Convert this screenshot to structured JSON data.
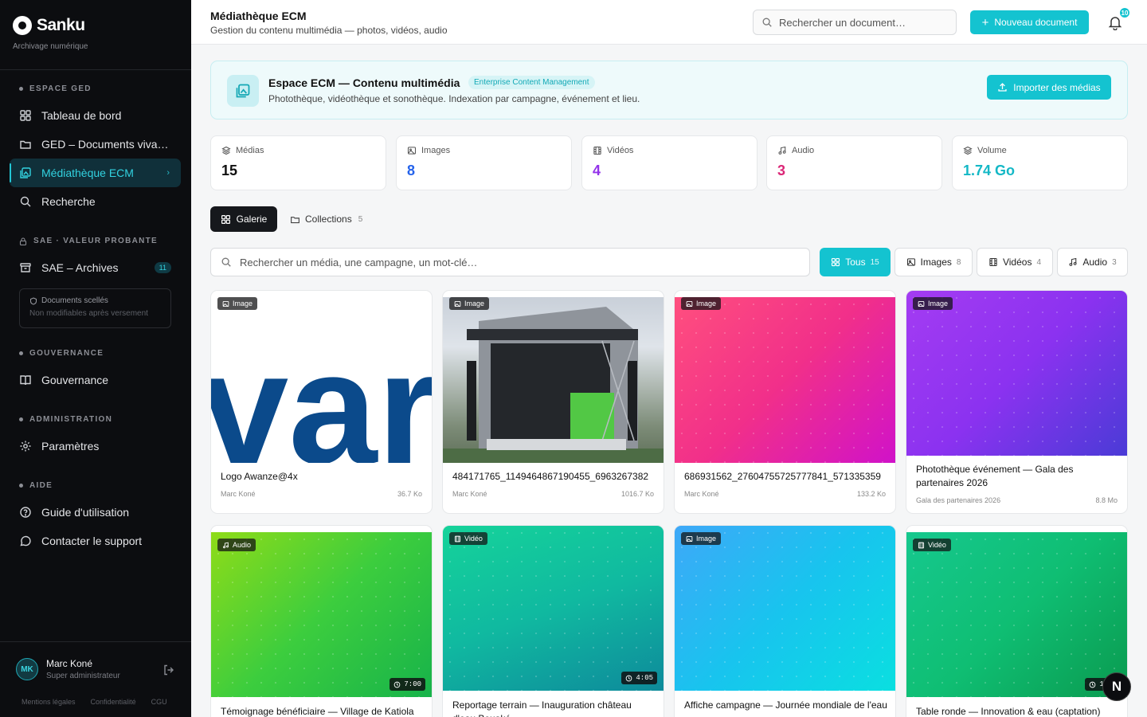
{
  "brand": {
    "name": "Sanku",
    "tagline": "Archivage numérique"
  },
  "sidebar": {
    "sections": [
      "ESPACE GED",
      "SAE · VALEUR PROBANTE",
      "GOUVERNANCE",
      "ADMINISTRATION",
      "AIDE"
    ],
    "items": [
      {
        "label": "Tableau de bord"
      },
      {
        "label": "GED – Documents vivants"
      },
      {
        "label": "Médiathèque ECM"
      },
      {
        "label": "Recherche"
      },
      {
        "label": "SAE – Archives",
        "badge": "11"
      },
      {
        "label": "Gouvernance"
      },
      {
        "label": "Paramètres"
      },
      {
        "label": "Guide d'utilisation"
      },
      {
        "label": "Contacter le support"
      }
    ],
    "sealed": {
      "title": "Documents scellés",
      "subtitle": "Non modifiables après versement"
    },
    "user": {
      "initials": "MK",
      "name": "Marc Koné",
      "role": "Super administrateur"
    },
    "footer": [
      "Mentions légales",
      "Confidentialité",
      "CGU"
    ]
  },
  "topbar": {
    "title": "Médiathèque ECM",
    "subtitle": "Gestion du contenu multimédia — photos, vidéos, audio",
    "search_placeholder": "Rechercher un document…",
    "new_doc": "Nouveau document",
    "notif_count": "10"
  },
  "banner": {
    "title": "Espace ECM — Contenu multimédia",
    "tag": "Enterprise Content Management",
    "subtitle": "Photothèque, vidéothèque et sonothèque. Indexation par campagne, événement et lieu.",
    "import": "Importer des médias"
  },
  "stats": [
    {
      "label": "Médias",
      "value": "15",
      "color": "#111111",
      "icon": "layers-icon"
    },
    {
      "label": "Images",
      "value": "8",
      "color": "#2563eb",
      "icon": "image-icon"
    },
    {
      "label": "Vidéos",
      "value": "4",
      "color": "#9333ea",
      "icon": "film-icon"
    },
    {
      "label": "Audio",
      "value": "3",
      "color": "#db2777",
      "icon": "music-icon"
    },
    {
      "label": "Volume",
      "value": "1.74 Go",
      "color": "#14b8c6",
      "icon": "database-icon"
    }
  ],
  "tabs": {
    "gallery": "Galerie",
    "collections": "Collections",
    "collections_count": "5"
  },
  "media_search_placeholder": "Rechercher un média, une campagne, un mot-clé…",
  "filters": [
    {
      "label": "Tous",
      "count": "15"
    },
    {
      "label": "Images",
      "count": "8"
    },
    {
      "label": "Vidéos",
      "count": "4"
    },
    {
      "label": "Audio",
      "count": "3"
    }
  ],
  "cards": [
    {
      "type": "Image",
      "title": "Logo Awanze@4x",
      "author": "Marc Koné",
      "size": "36.7 Ko"
    },
    {
      "type": "Image",
      "title": "484171765_1149464867190455_6963267382",
      "author": "Marc Koné",
      "size": "1016.7 Ko"
    },
    {
      "type": "Image",
      "title": "686931562_27604755725777841_571335359",
      "author": "Marc Koné",
      "size": "133.2 Ko"
    },
    {
      "type": "Image",
      "title": "Photothèque événement — Gala des partenaires 2026",
      "author": "Gala des partenaires 2026",
      "size": "8.8 Mo"
    },
    {
      "type": "Audio",
      "title": "Témoignage bénéficiaire — Village de Katiola",
      "duration": "7:00"
    },
    {
      "type": "Vidéo",
      "title": "Reportage terrain — Inauguration château d'eau Bouaké",
      "duration": "4:05"
    },
    {
      "type": "Image",
      "title": "Affiche campagne — Journée mondiale de l'eau"
    },
    {
      "type": "Vidéo",
      "title": "Table ronde — Innovation & eau (captation)",
      "duration": "1:00"
    }
  ],
  "logo_art": "var",
  "fab": "N"
}
